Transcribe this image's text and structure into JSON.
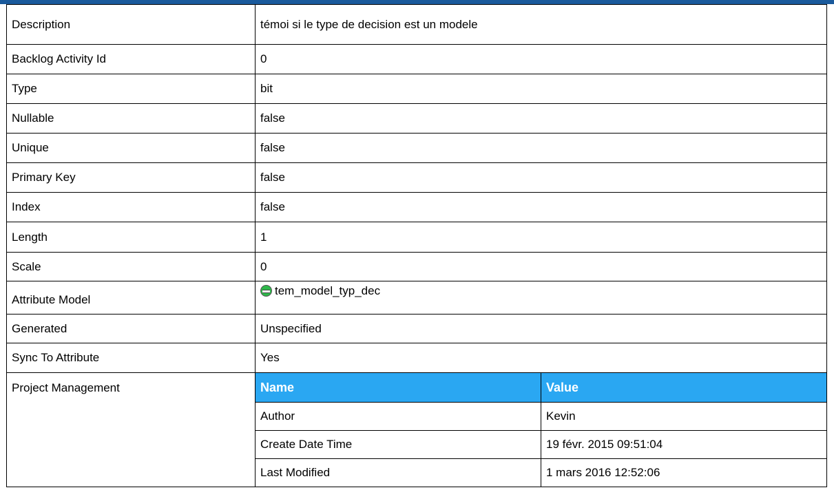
{
  "properties": {
    "description": {
      "label": "Description",
      "value": "témoi si le type de decision est un modele"
    },
    "backlog_activity_id": {
      "label": "Backlog Activity Id",
      "value": "0"
    },
    "type": {
      "label": "Type",
      "value": "bit"
    },
    "nullable": {
      "label": "Nullable",
      "value": "false"
    },
    "unique": {
      "label": "Unique",
      "value": "false"
    },
    "primary_key": {
      "label": "Primary Key",
      "value": "false"
    },
    "index": {
      "label": "Index",
      "value": "false"
    },
    "length": {
      "label": "Length",
      "value": "1"
    },
    "scale": {
      "label": "Scale",
      "value": "0"
    },
    "attribute_model": {
      "label": "Attribute Model",
      "value": "tem_model_typ_dec",
      "icon": "attribute-icon"
    },
    "generated": {
      "label": "Generated",
      "value": "Unspecified"
    },
    "sync_to_attribute": {
      "label": "Sync To Attribute",
      "value": "Yes"
    }
  },
  "project_management": {
    "label": "Project Management",
    "header_name": "Name",
    "header_value": "Value",
    "rows": [
      {
        "name": "Author",
        "value": "Kevin"
      },
      {
        "name": "Create Date Time",
        "value": "19 févr. 2015 09:51:04"
      },
      {
        "name": "Last Modified",
        "value": "1 mars 2016 12:52:06"
      }
    ]
  },
  "colors": {
    "header_bar": "#1a5a9c",
    "table_header": "#2aa7f2"
  }
}
